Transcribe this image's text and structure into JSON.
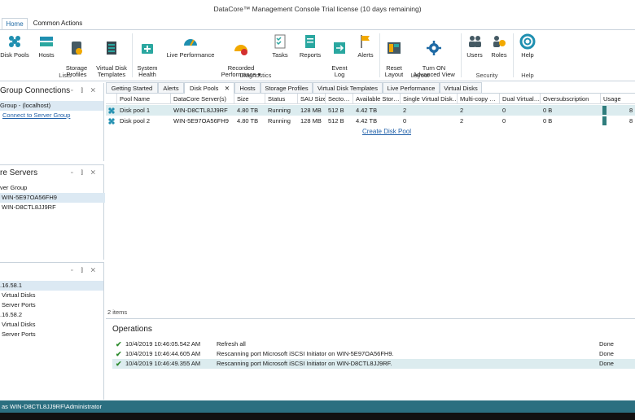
{
  "window": {
    "title": "DataCore™ Management Console   Trial license (10 days remaining)"
  },
  "ribbon_tabs": [
    {
      "label": "Home",
      "active": true
    },
    {
      "label": "Common Actions",
      "active": false
    }
  ],
  "ribbon": {
    "buttons": [
      {
        "label": "Disk Pools",
        "icon": "disk-pools-icon"
      },
      {
        "label": "Hosts",
        "icon": "hosts-icon"
      },
      {
        "label": "Storage\nProfiles",
        "icon": "storage-profiles-icon"
      },
      {
        "label": "Virtual Disk\nTemplates",
        "icon": "virtual-disk-templates-icon"
      },
      {
        "label": "System\nHealth",
        "icon": "system-health-icon"
      },
      {
        "label": "Live Performance",
        "icon": "live-performance-icon"
      },
      {
        "label": "Recorded\nPerformance ▾",
        "icon": "recorded-performance-icon"
      },
      {
        "label": "Tasks",
        "icon": "tasks-icon"
      },
      {
        "label": "Reports",
        "icon": "reports-icon"
      },
      {
        "label": "Event\nLog",
        "icon": "event-log-icon"
      },
      {
        "label": "Alerts",
        "icon": "alerts-icon"
      },
      {
        "label": "Reset\nLayout",
        "icon": "reset-layout-icon"
      },
      {
        "label": "Turn ON\nAdvanced View",
        "icon": "advanced-view-icon"
      },
      {
        "label": "Users",
        "icon": "users-icon"
      },
      {
        "label": "Roles",
        "icon": "roles-icon"
      },
      {
        "label": "Help",
        "icon": "help-icon"
      }
    ],
    "groups": [
      "Lists",
      "Diagnostics",
      "Layout",
      "Security",
      "Help"
    ]
  },
  "panes": {
    "group_connections": {
      "title": "Group Connections",
      "items": [
        "Group - (localhost)",
        "Connect to Server Group"
      ]
    },
    "servers": {
      "title": "re Servers",
      "items": [
        "ver Group",
        "WIN-5E97OA56FH9",
        "WIN-D8CTL8JJ9RF"
      ]
    },
    "ports": {
      "items": [
        ".16.58.1",
        "Virtual Disks",
        "Server Ports",
        ".16.58.2",
        "Virtual Disks",
        "Server Ports"
      ]
    },
    "pane_buttons": "▫ ⫿ ✕"
  },
  "doc_tabs": [
    "Getting Started",
    "Alerts",
    "Disk Pools",
    "Hosts",
    "Storage Profiles",
    "Virtual Disk Templates",
    "Live Performance",
    "Virtual Disks"
  ],
  "doc_tab_close": "✕",
  "grid": {
    "columns": [
      "Pool Name",
      "DataCore Server(s)",
      "Size",
      "Status",
      "SAU Size",
      "Secto…",
      "Available Stor…",
      "Single Virtual Disk…",
      "Multi-copy …",
      "Dual Virtual…",
      "Oversubscription",
      "Usage"
    ],
    "rows": [
      [
        "Disk pool 1",
        "WIN-D8CTL8JJ9RF",
        "4.80 TB",
        "Running",
        "128 MB",
        "512 B",
        "4.42 TB",
        "2",
        "2",
        "0",
        "0 B",
        "8"
      ],
      [
        "Disk pool 2",
        "WIN-5E97OA56FH9",
        "4.80 TB",
        "Running",
        "128 MB",
        "512 B",
        "4.42 TB",
        "0",
        "2",
        "0",
        "0 B",
        "8"
      ]
    ],
    "create_link": "Create Disk Pool",
    "item_count": "2 items"
  },
  "operations": {
    "title": "Operations",
    "rows": [
      {
        "time": "10/4/2019 10:46:05.542 AM",
        "desc": "Refresh all",
        "status": "Done"
      },
      {
        "time": "10/4/2019 10:46:44.605 AM",
        "desc": "Rescanning port Microsoft iSCSI Initiator on WIN-5E97OA56FH9.",
        "status": "Done"
      },
      {
        "time": "10/4/2019 10:46:49.355 AM",
        "desc": "Rescanning port Microsoft iSCSI Initiator on WIN-D8CTL8JJ9RF.",
        "status": "Done"
      }
    ]
  },
  "statusbar": {
    "text": "as WIN-D8CTL8JJ9RF\\Administrator"
  },
  "colors": {
    "accent": "#1f6aa5",
    "statusbar": "#2b6f80",
    "usage": "#2f7d7d",
    "selected_row": "#dcecef"
  }
}
